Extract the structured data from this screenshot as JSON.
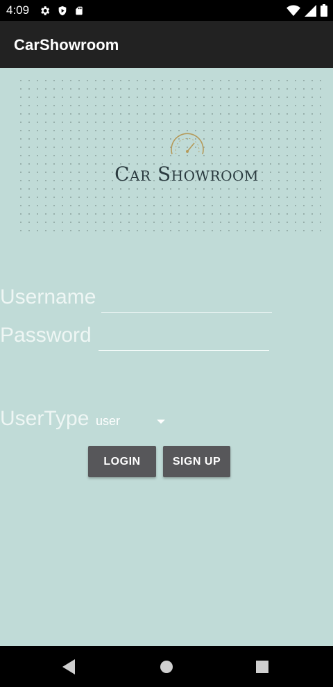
{
  "status_bar": {
    "time": "4:09",
    "icons_left": [
      "gear-icon",
      "play-protect-icon",
      "sd-card-icon"
    ],
    "icons_right": [
      "wifi-icon",
      "signal-icon",
      "battery-icon"
    ]
  },
  "app_bar": {
    "title": "CarShowroom"
  },
  "logo": {
    "text": "Car Showroom"
  },
  "form": {
    "username_label": "Username",
    "password_label": "Password",
    "usertype_label": "UserType",
    "usertype_value": "user"
  },
  "buttons": {
    "login": "LOGIN",
    "signup": "SIGN UP"
  },
  "nav": [
    "back-icon",
    "home-icon",
    "recents-icon"
  ],
  "colors": {
    "background": "#c0dbd7",
    "app_bar": "#222222",
    "button": "#57575a"
  }
}
